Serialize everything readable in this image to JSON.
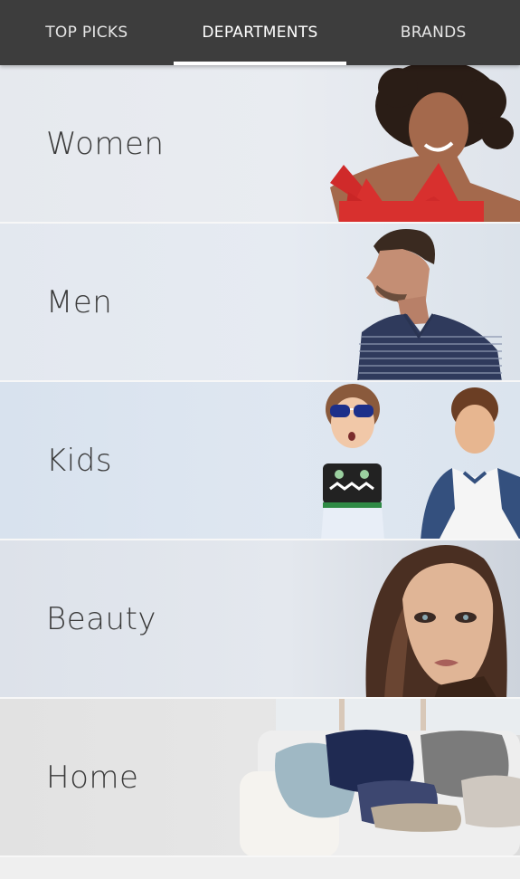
{
  "tabs": [
    {
      "label": "TOP PICKS",
      "active": false
    },
    {
      "label": "DEPARTMENTS",
      "active": true
    },
    {
      "label": "BRANDS",
      "active": false
    }
  ],
  "departments": [
    {
      "label": "Women",
      "image": "woman-red-top-photo"
    },
    {
      "label": "Men",
      "image": "man-striped-polo-photo"
    },
    {
      "label": "Kids",
      "image": "kids-sunglasses-photo"
    },
    {
      "label": "Beauty",
      "image": "woman-portrait-photo"
    },
    {
      "label": "Home",
      "image": "pillows-sofa-photo"
    }
  ],
  "colors": {
    "tabbar_bg": "#3d3d3d",
    "tab_active_indicator": "#ffffff",
    "label_text": "#3a3a3a"
  }
}
